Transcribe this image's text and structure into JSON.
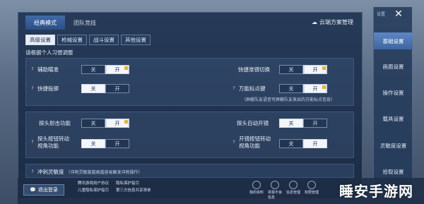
{
  "top_tabs": {
    "classic": "经典模式",
    "team": "团队竞技"
  },
  "cloud_label": "云端方案管理",
  "sub_tabs": [
    "高级设置",
    "枪械设置",
    "战斗设置",
    "其他设置"
  ],
  "hint": "请根据个人习惯调整",
  "toggle_off": "关",
  "toggle_on": "开",
  "rows": {
    "aim_assist": "辅助瞄准",
    "quick_scope": "快捷准镜切换",
    "quick_throw": "快捷投掷",
    "universal_mark": "万能标点键",
    "mark_note": "（屏蔽队友语音可屏蔽队友发出的万能标点信息）",
    "peek_fire": "探头射击功能",
    "peek_auto_scope": "探头自动开镜",
    "peek_button_view": "探头按钮转动视角功能",
    "scope_button_view": "开镜按钮转动视角功能",
    "sprint_sense": "冲刺灵敏度",
    "sprint_note": "（冲刺灵敏度越高越容易触发冲刺操作）"
  },
  "rail": {
    "mini": "设置",
    "items": [
      "基础设置",
      "画面设置",
      "操作设置",
      "载具设置",
      "灵敏度设置",
      "拾取设置"
    ]
  },
  "footer": {
    "logout": "退出登录",
    "links_row1": [
      "腾讯游戏用户协议",
      "隐私保护指引"
    ],
    "links_row2": [
      "儿童隐私保护指引",
      "第三方信息共享清单"
    ],
    "icons": [
      "我的资料",
      "举报不良信息",
      "信息管理",
      "权限管理"
    ]
  },
  "watermark": "睡安手游网"
}
